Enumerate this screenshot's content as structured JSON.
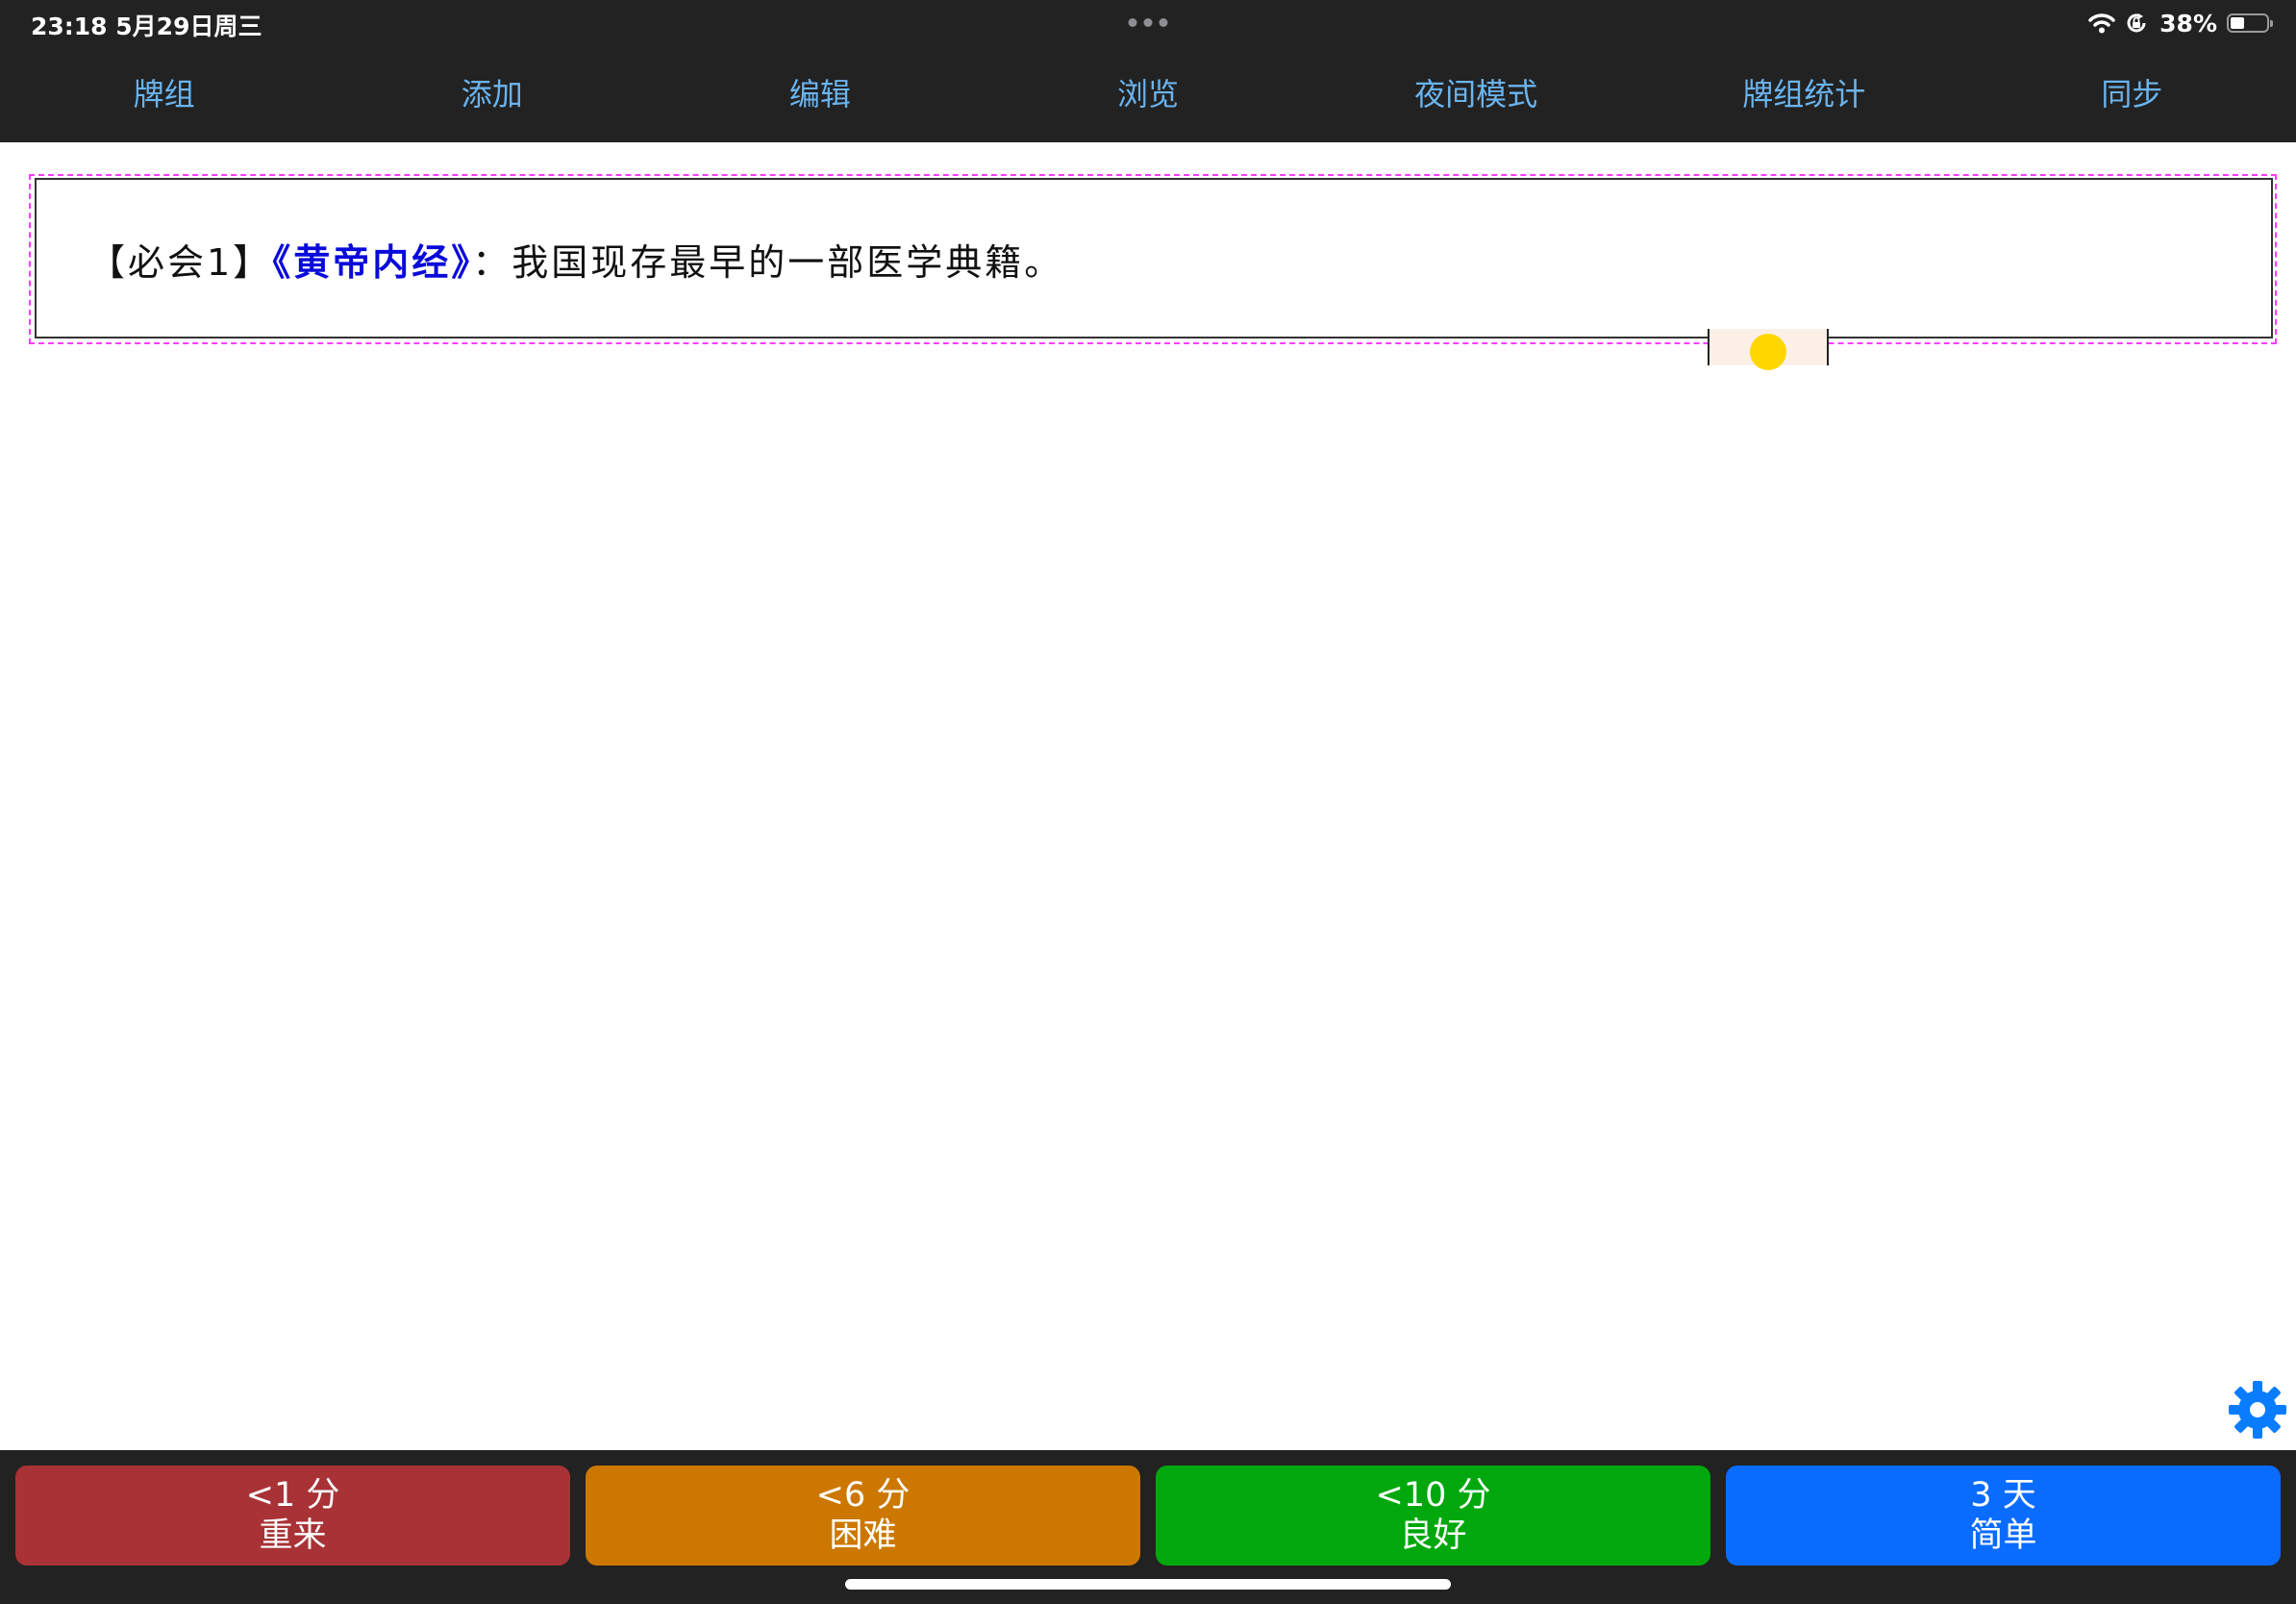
{
  "status": {
    "time_date": "23:18   5月29日周三",
    "battery": "38%",
    "battery_level": 0.38
  },
  "nav": [
    {
      "label": "牌组"
    },
    {
      "label": "添加"
    },
    {
      "label": "编辑"
    },
    {
      "label": "浏览"
    },
    {
      "label": "夜间模式"
    },
    {
      "label": "牌组统计"
    },
    {
      "label": "同步"
    }
  ],
  "card": {
    "prefix": "【必会1】",
    "title": "《黄帝内经》",
    "separator": "：",
    "content": "我国现存最早的一部医学典籍。"
  },
  "answers": [
    {
      "interval": "<1 分",
      "label": "重来",
      "color": "#a83236"
    },
    {
      "interval": "<6 分",
      "label": "困难",
      "color": "#cc7800"
    },
    {
      "interval": "<10 分",
      "label": "良好",
      "color": "#00a80d"
    },
    {
      "interval": "3 天",
      "label": "简单",
      "color": "#0a6cff"
    }
  ],
  "colors": {
    "nav_text": "#6ab4ef",
    "gear": "#0a7cff",
    "card_title": "#0a0adb"
  },
  "icons": [
    "wifi-icon",
    "orientation-lock-icon",
    "battery-icon",
    "gear-icon",
    "multitasking-dots-icon"
  ]
}
